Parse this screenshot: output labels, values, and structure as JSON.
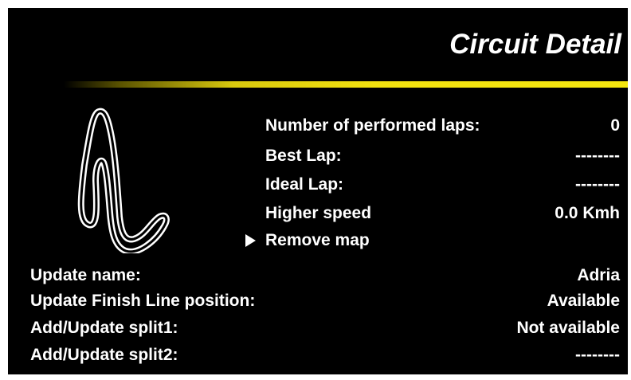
{
  "header": {
    "title": "Circuit Detail"
  },
  "colors": {
    "background": "#000000",
    "text": "#ffffff",
    "accent": "#f1e10f"
  },
  "map": {
    "icon": "track-outline-icon"
  },
  "stats": [
    {
      "label": "Number of performed laps:",
      "value": "0"
    },
    {
      "label": "Best Lap:",
      "value": "--------"
    },
    {
      "label": "Ideal Lap:",
      "value": "--------"
    },
    {
      "label": "Higher speed",
      "value": "0.0 Kmh"
    }
  ],
  "menu": {
    "remove_map": "Remove map"
  },
  "updates": [
    {
      "label": "Update name:",
      "value": "Adria"
    },
    {
      "label": "Update Finish Line position:",
      "value": "Available"
    },
    {
      "label": "Add/Update split1:",
      "value": "Not available"
    },
    {
      "label": "Add/Update split2:",
      "value": "--------"
    }
  ]
}
